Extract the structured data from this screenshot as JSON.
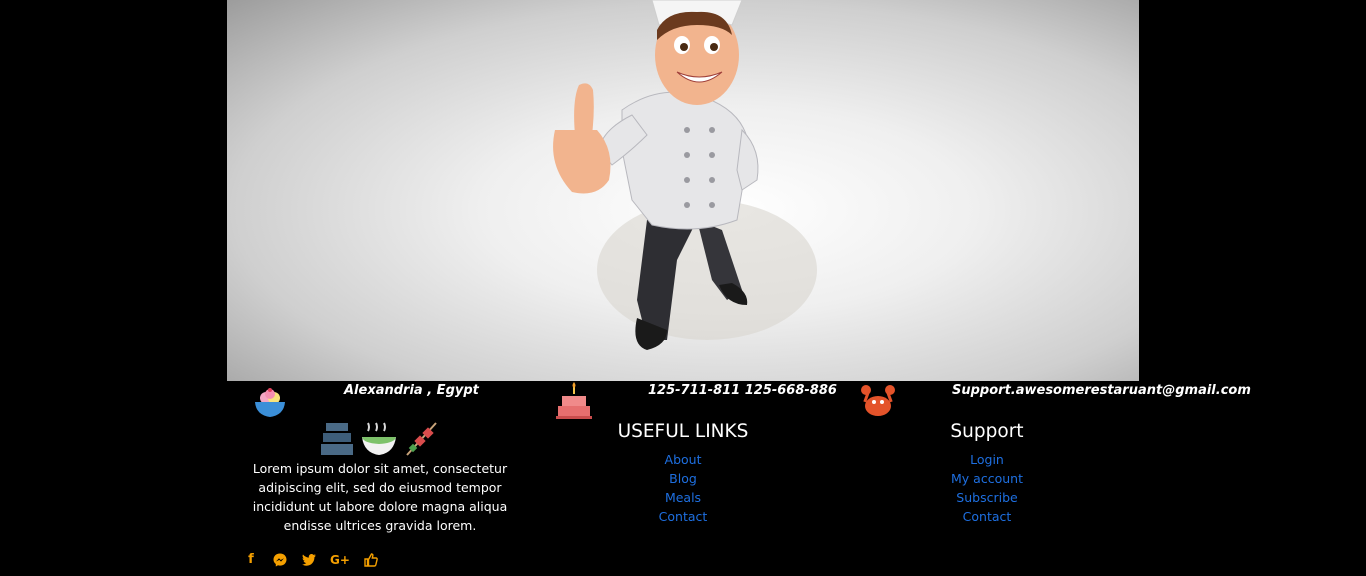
{
  "hero": {
    "alt": "cartoon chef giving a thumbs up"
  },
  "contact": {
    "address": "Alexandria , Egypt",
    "phone": "125-711-811 125-668-886",
    "email": "Support.awesomerestaruant@gmail.com"
  },
  "about": {
    "text": "Lorem ipsum dolor sit amet, consectetur adipiscing elit, sed do eiusmod tempor incididunt ut labore dolore magna aliqua endisse ultrices gravida lorem."
  },
  "social": {
    "icons": [
      "facebook-icon",
      "messenger-icon",
      "twitter-icon",
      "google-plus-icon",
      "thumbs-up-icon"
    ],
    "color": "#f5a000"
  },
  "useful_links": {
    "title": "USEFUL LINKS",
    "items": [
      "About",
      "Blog",
      "Meals",
      "Contact"
    ]
  },
  "support": {
    "title": "Support",
    "items": [
      "Login",
      "My account",
      "Subscribe",
      "Contact"
    ]
  },
  "colors": {
    "link": "#1e6fe0",
    "background": "#000000"
  }
}
